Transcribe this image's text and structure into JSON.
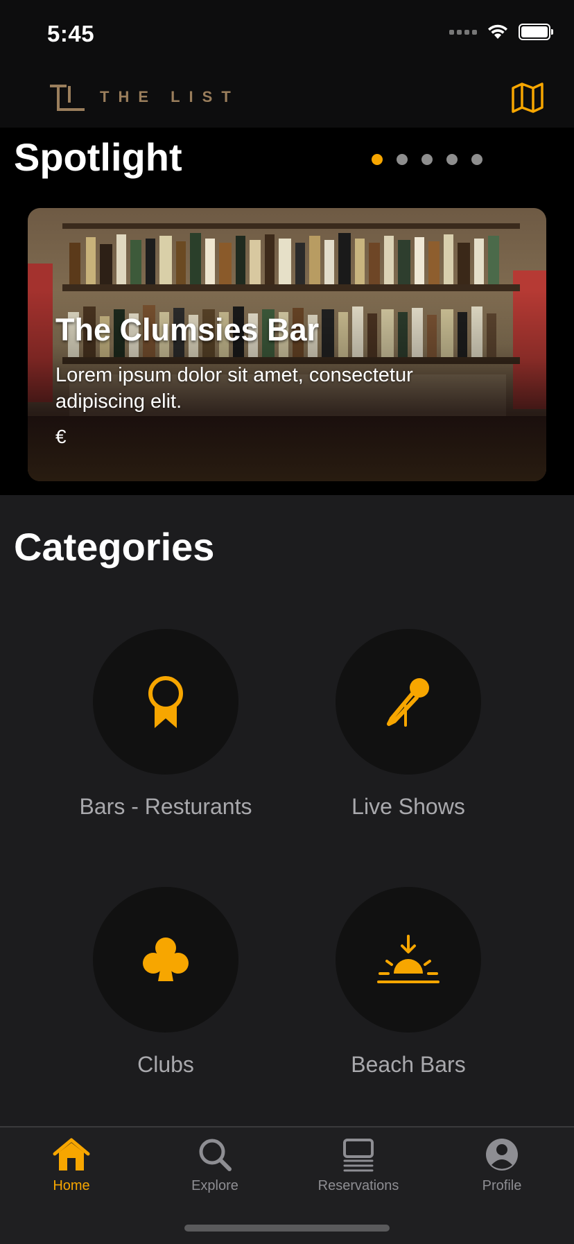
{
  "status_bar": {
    "time": "5:45"
  },
  "header": {
    "logo_text": "THE LIST",
    "accent_color": "#f7a600",
    "logo_color": "#9a7e5c"
  },
  "spotlight": {
    "title": "Spotlight",
    "page_count": 5,
    "active_page": 1,
    "card": {
      "title": "The Clumsies Bar",
      "description": "Lorem ipsum dolor sit amet, consectetur adipiscing elit.",
      "price": "€"
    }
  },
  "categories": {
    "title": "Categories",
    "items": [
      {
        "label": "Bars - Resturants",
        "icon": "award-ribbon-icon"
      },
      {
        "label": "Live Shows",
        "icon": "microphone-icon"
      },
      {
        "label": "Clubs",
        "icon": "club-suit-icon"
      },
      {
        "label": "Beach Bars",
        "icon": "sunset-icon"
      }
    ]
  },
  "tabbar": {
    "items": [
      {
        "label": "Home",
        "icon": "house-icon",
        "active": true
      },
      {
        "label": "Explore",
        "icon": "search-icon",
        "active": false
      },
      {
        "label": "Reservations",
        "icon": "list-icon",
        "active": false
      },
      {
        "label": "Profile",
        "icon": "person-circle-icon",
        "active": false
      }
    ]
  }
}
